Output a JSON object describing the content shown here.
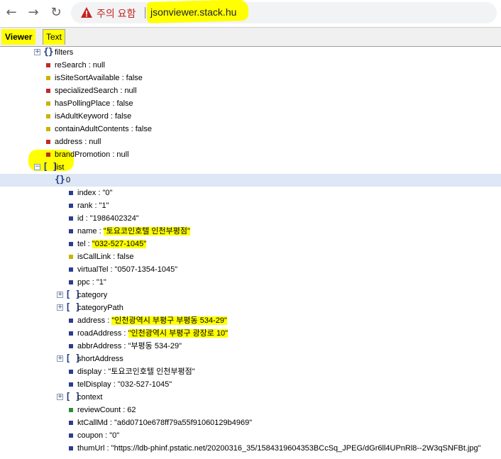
{
  "browser": {
    "back_glyph": "←",
    "forward_glyph": "→",
    "reload_glyph": "↻",
    "warning_text": "주의 요함",
    "url": "jsonviewer.stack.hu"
  },
  "tabs": {
    "viewer": "Viewer",
    "text": "Text"
  },
  "tree": {
    "filters": "filters",
    "reSearch": "reSearch : null",
    "isSiteSortAvailable": "isSiteSortAvailable : false",
    "specializedSearch": "specializedSearch : null",
    "hasPollingPlace": "hasPollingPlace : false",
    "isAdultKeyword": "isAdultKeyword : false",
    "containAdultContents": "containAdultContents : false",
    "address_null": "address : null",
    "brandPromotion": "brandPromotion : null",
    "list": "list",
    "item0": "0",
    "index": "index : \"0\"",
    "rank": "rank : \"1\"",
    "id": "id : \"1986402324\"",
    "name_key": "name : ",
    "name_val": "\"토요코인호텔 인천부평점\"",
    "tel_key": "tel : ",
    "tel_val": "\"032-527-1045\"",
    "isCallLink": "isCallLink : false",
    "virtualTel": "virtualTel : \"0507-1354-1045\"",
    "ppc": "ppc : \"1\"",
    "category": "category",
    "categoryPath": "categoryPath",
    "address_key": "address : ",
    "address_val": "\"인천광역시 부평구 부평동 534-29\"",
    "roadAddress_key": "roadAddress : ",
    "roadAddress_val": "\"인천광역시 부평구 광장로 10\"",
    "abbrAddress": "abbrAddress : \"부평동 534-29\"",
    "shortAddress": "shortAddress",
    "display": "display : \"토요코인호텔 인천부평점\"",
    "telDisplay": "telDisplay : \"032-527-1045\"",
    "context": "context",
    "reviewCount": "reviewCount : 62",
    "ktCallMd": "ktCallMd : \"a6d0710e678ff79a55f91060129b4969\"",
    "coupon": "coupon : \"0\"",
    "thumUrl": "thumUrl : \"https://ldb-phinf.pstatic.net/20200316_35/1584319604353BCcSq_JPEG/dGr6ll4UPnRl8--2W3qSNFBt.jpg\""
  },
  "icons": {
    "object": "{}",
    "array": "[ ]",
    "expand": "+",
    "collapse": "−"
  },
  "colors": {
    "highlight": "#ffff00",
    "null_square": "#c0282d",
    "bool_square": "#c8b400",
    "string_square": "#2c3d8f",
    "number_square": "#2e8b3a",
    "selected_row": "#dde7f5"
  }
}
